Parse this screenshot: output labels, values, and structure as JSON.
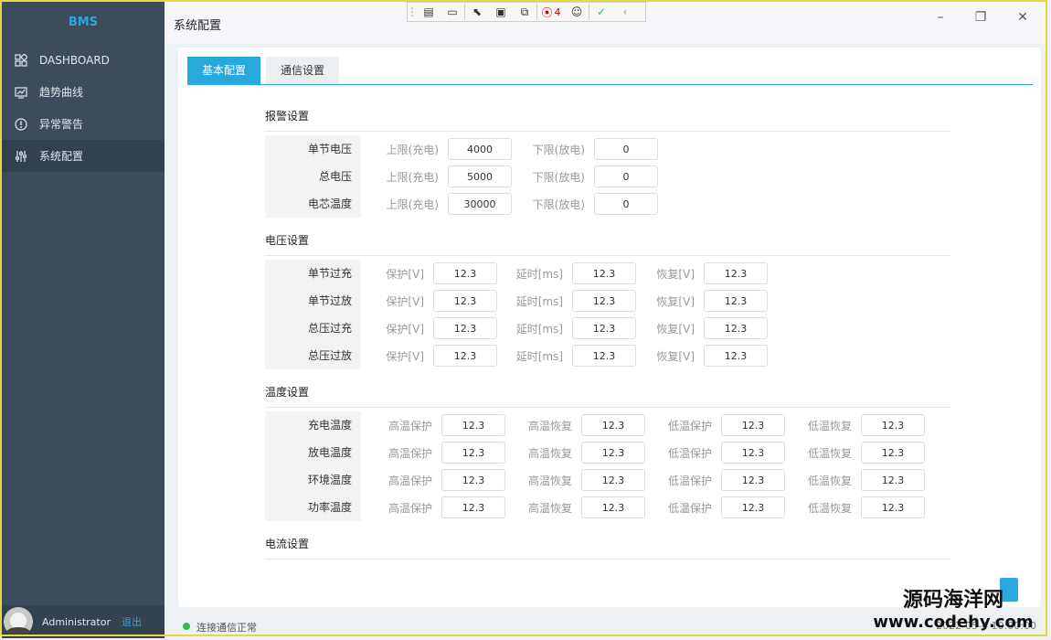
{
  "app": {
    "brand": "BMS",
    "page_title": "系统配置"
  },
  "sidebar": {
    "items": [
      {
        "label": "DASHBOARD",
        "icon": "grid-icon"
      },
      {
        "label": "趋势曲线",
        "icon": "monitor-chart-icon"
      },
      {
        "label": "异常警告",
        "icon": "alert-circle-icon"
      },
      {
        "label": "系统配置",
        "icon": "sliders-icon"
      }
    ],
    "active_index": 3,
    "user": {
      "name": "Administrator",
      "logout_label": "退出"
    }
  },
  "toolbar": {
    "issue_count": "4"
  },
  "tabs": [
    {
      "label": "基本配置",
      "active": true
    },
    {
      "label": "通信设置",
      "active": false
    }
  ],
  "alarm": {
    "title": "报警设置",
    "upper_label": "上限(充电)",
    "lower_label": "下限(放电)",
    "rows": [
      {
        "name": "单节电压",
        "upper": "4000",
        "lower": "0"
      },
      {
        "name": "总电压",
        "upper": "5000",
        "lower": "0"
      },
      {
        "name": "电芯温度",
        "upper": "30000",
        "lower": "0"
      }
    ]
  },
  "voltage": {
    "title": "电压设置",
    "protect_label": "保护[V]",
    "delay_label": "延时[ms]",
    "recover_label": "恢复[V]",
    "rows": [
      {
        "name": "单节过充",
        "protect": "12.3",
        "delay": "12.3",
        "recover": "12.3"
      },
      {
        "name": "单节过放",
        "protect": "12.3",
        "delay": "12.3",
        "recover": "12.3"
      },
      {
        "name": "总压过充",
        "protect": "12.3",
        "delay": "12.3",
        "recover": "12.3"
      },
      {
        "name": "总压过放",
        "protect": "12.3",
        "delay": "12.3",
        "recover": "12.3"
      }
    ]
  },
  "temperature": {
    "title": "温度设置",
    "high_protect_label": "高温保护",
    "high_recover_label": "高温恢复",
    "low_protect_label": "低温保护",
    "low_recover_label": "低温恢复",
    "rows": [
      {
        "name": "充电温度",
        "hp": "12.3",
        "hr": "12.3",
        "lp": "12.3",
        "lr": "12.3"
      },
      {
        "name": "放电温度",
        "hp": "12.3",
        "hr": "12.3",
        "lp": "12.3",
        "lr": "12.3"
      },
      {
        "name": "环境温度",
        "hp": "12.3",
        "hr": "12.3",
        "lp": "12.3",
        "lr": "12.3"
      },
      {
        "name": "功率温度",
        "hp": "12.3",
        "hr": "12.3",
        "lp": "12.3",
        "lr": "12.3"
      }
    ]
  },
  "current": {
    "title": "电流设置"
  },
  "status": {
    "text": "连接通信正常",
    "time": "2022-05-4 10:00:00"
  },
  "watermark": {
    "line1": "源码海洋网",
    "line2": "www.codehy.com"
  },
  "colors": {
    "accent": "#29a8e0",
    "sidebar": "#3e4b5c",
    "ok": "#2ebd59"
  }
}
